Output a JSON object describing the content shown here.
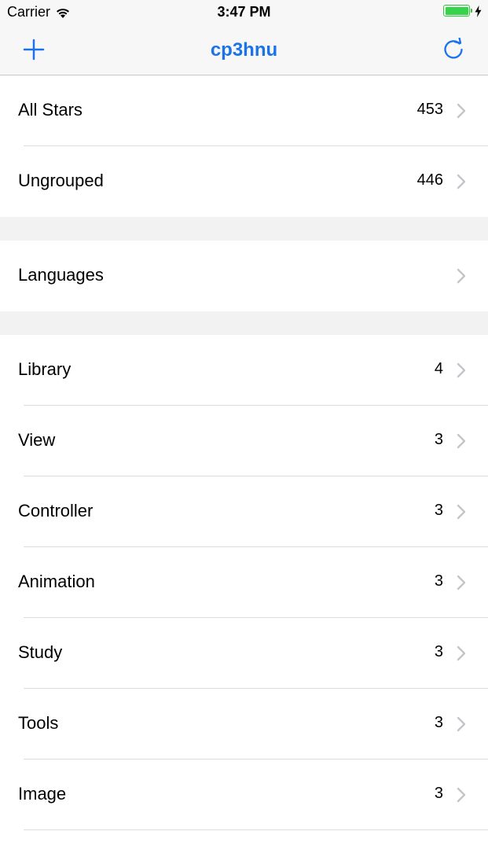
{
  "status_bar": {
    "carrier": "Carrier",
    "time": "3:47 PM",
    "wifi_icon": "wifi-icon",
    "battery_icon": "battery-icon",
    "charging_icon": "bolt-icon",
    "battery_color": "#35d44a"
  },
  "nav": {
    "title": "cp3hnu",
    "add_icon": "plus-icon",
    "refresh_icon": "refresh-icon",
    "accent_color": "#1a73e8"
  },
  "sections": [
    {
      "rows": [
        {
          "label": "All Stars",
          "count": "453"
        },
        {
          "label": "Ungrouped",
          "count": "446"
        }
      ]
    },
    {
      "rows": [
        {
          "label": "Languages",
          "count": ""
        }
      ]
    },
    {
      "rows": [
        {
          "label": "Library",
          "count": "4"
        },
        {
          "label": "View",
          "count": "3"
        },
        {
          "label": "Controller",
          "count": "3"
        },
        {
          "label": "Animation",
          "count": "3"
        },
        {
          "label": "Study",
          "count": "3"
        },
        {
          "label": "Tools",
          "count": "3"
        },
        {
          "label": "Image",
          "count": "3"
        }
      ]
    }
  ]
}
